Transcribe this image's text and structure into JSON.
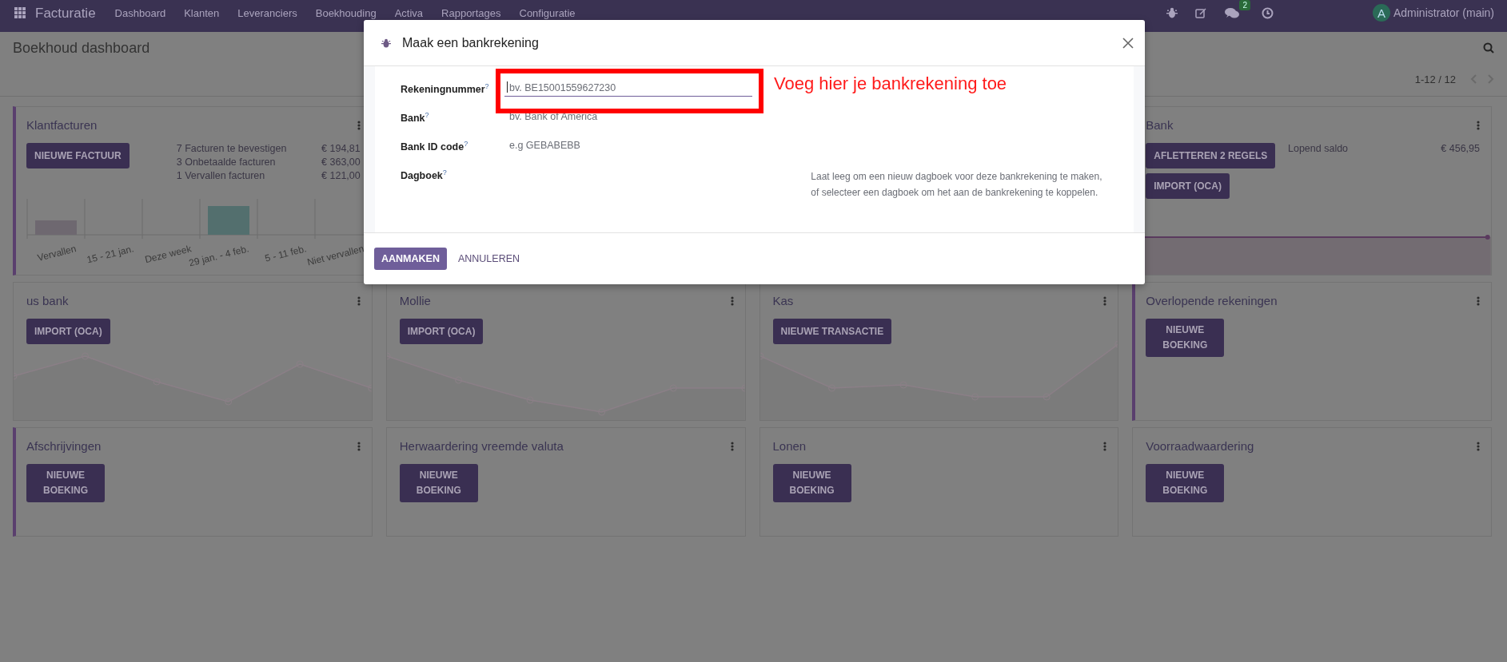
{
  "navbar": {
    "app_name": "Facturatie",
    "menu": [
      "Dashboard",
      "Klanten",
      "Leveranciers",
      "Boekhouding",
      "Activa",
      "Rapportages",
      "Configuratie"
    ],
    "chat_badge": "2",
    "user_initial": "A",
    "user_name": "Administrator (main)"
  },
  "control_panel": {
    "title": "Boekhoud dashboard",
    "pager": "1-12 / 12"
  },
  "cards": [
    {
      "title": "Klantfacturen",
      "accent": true,
      "buttons": [
        "NIEUWE FACTUUR"
      ],
      "stats": [
        {
          "label": "7 Facturen te bevestigen",
          "value": "€ 194,81"
        },
        {
          "label": "3 Onbetaalde facturen",
          "value": "€ 363,00"
        },
        {
          "label": "1 Vervallen facturen",
          "value": "€ 121,00"
        }
      ],
      "kind": "bar",
      "bar_labels": [
        "Vervallen",
        "15 - 21 jan.",
        "Deze week",
        "29 jan. - 4 feb.",
        "5 - 11 feb.",
        "Niet vervallen"
      ]
    },
    {
      "title": "Bank",
      "buttons": [
        "AFLETTEREN 2 REGELS",
        "IMPORT (OCA)"
      ],
      "stats": [
        {
          "label": "Lopend saldo",
          "value": "€ 456,95"
        }
      ],
      "kind": "area"
    },
    {
      "title": "us bank",
      "accent": false,
      "buttons": [
        "IMPORT (OCA)"
      ],
      "kind": "line"
    },
    {
      "title": "Mollie",
      "accent": false,
      "buttons": [
        "IMPORT (OCA)"
      ],
      "kind": "line"
    },
    {
      "title": "Kas",
      "accent": false,
      "buttons": [
        "NIEUWE TRANSACTIE"
      ],
      "kind": "line"
    },
    {
      "title": "Overlopende rekeningen",
      "accent": true,
      "buttons": [
        "NIEUWE BOEKING"
      ]
    },
    {
      "title": "Afschrijvingen",
      "accent": true,
      "buttons": [
        "NIEUWE BOEKING"
      ]
    },
    {
      "title": "Herwaardering vreemde valuta",
      "accent": false,
      "buttons": [
        "NIEUWE BOEKING"
      ]
    },
    {
      "title": "Lonen",
      "accent": false,
      "buttons": [
        "NIEUWE BOEKING"
      ]
    },
    {
      "title": "Voorraadwaardering",
      "accent": false,
      "buttons": [
        "NIEUWE BOEKING"
      ]
    }
  ],
  "dialog": {
    "title": "Maak een bankrekening",
    "fields": [
      {
        "label": "Rekeningnummer$^{?}$",
        "placeholder": "bv. BE15001559627230",
        "focused": true
      },
      {
        "label": "Bank$^{?}$",
        "placeholder": "bv. Bank of America",
        "focused": false
      },
      {
        "label": "Bank ID code$^{?}$",
        "placeholder": "e.g GEBABEBB",
        "focused": false
      },
      {
        "label": "Dagboek$^{?}$",
        "help": "Laat leeg om een nieuw dagboek voor deze bankrekening te maken, of selecteer een dagboek om het aan de bankrekening te koppelen."
      }
    ],
    "primary_button": "AANMAKEN",
    "secondary_button": "ANNULEREN"
  },
  "annotation": {
    "text": "Voeg hier je bankrekening toe"
  }
}
